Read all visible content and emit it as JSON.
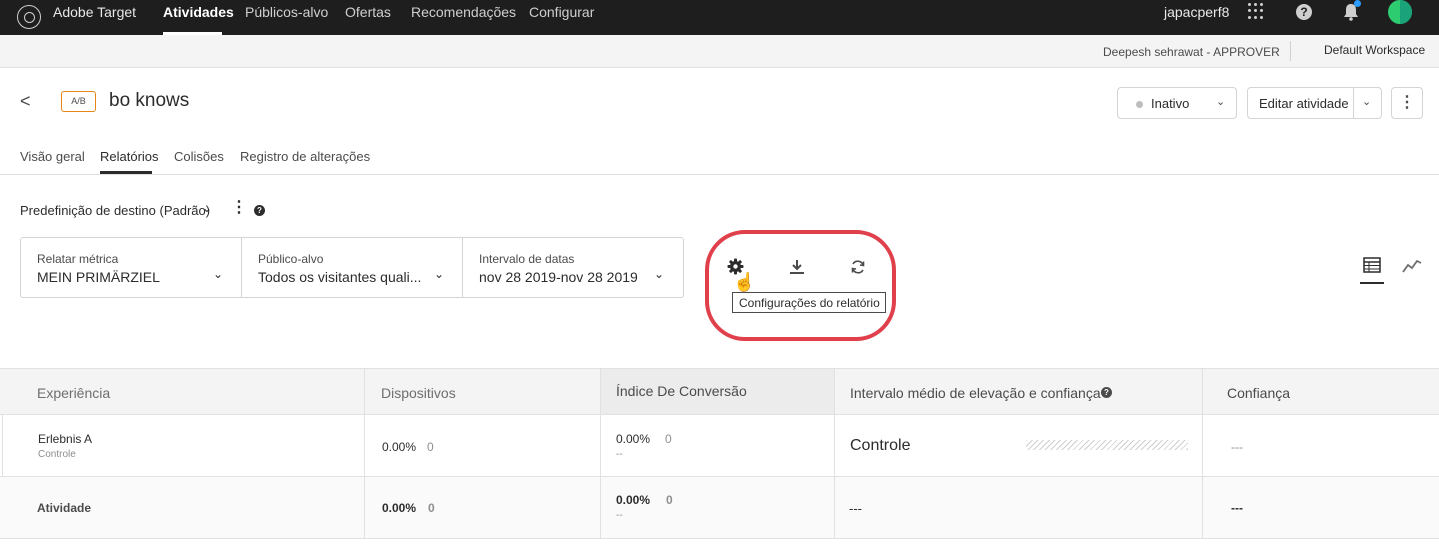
{
  "topnav": {
    "brand": "Adobe Target",
    "items": [
      {
        "label": "Atividades",
        "active": true
      },
      {
        "label": "Públicos-alvo"
      },
      {
        "label": "Ofertas"
      },
      {
        "label": "Recomendações"
      },
      {
        "label": "Configurar"
      }
    ],
    "user": "japacperf8",
    "help": "?"
  },
  "workspace_bar": {
    "user_role": "Deepesh sehrawat - APPROVER",
    "workspace": "Default Workspace"
  },
  "activity": {
    "back": "<",
    "type_badge": "A/B",
    "title": "bo knows",
    "status": "Inativo",
    "edit_label": "Editar atividade",
    "more": "⋮"
  },
  "tabs": [
    {
      "label": "Visão geral"
    },
    {
      "label": "Relatórios",
      "active": true
    },
    {
      "label": "Colisões"
    },
    {
      "label": "Registro de alterações"
    }
  ],
  "preset": {
    "label": "Predefinição de destino (Padrão)",
    "kebab": "⋮",
    "help": "?"
  },
  "selectors": [
    {
      "caption": "Relatar métrica",
      "value": "MEIN PRIMÄRZIEL"
    },
    {
      "caption": "Público-alvo",
      "value": "Todos os visitantes quali..."
    },
    {
      "caption": "Intervalo de datas",
      "value": "nov 28 2019-nov 28 2019"
    }
  ],
  "toolbar": {
    "settings_icon": "gear-icon",
    "download_icon": "download-icon",
    "refresh_icon": "refresh-icon",
    "tooltip": "Configurações do relatório",
    "highlight_color": "#e0404b"
  },
  "table": {
    "headers": [
      "Experiência",
      "Dispositivos",
      "Índice De Conversão",
      "Intervalo médio de elevação e confiança",
      "Confiança"
    ],
    "header_help": "?",
    "rows": [
      {
        "experience": "Erlebnis A",
        "sub": "Controle",
        "devices_pct": "0.00%",
        "devices_count": "0",
        "conv_pct": "0.00%",
        "conv_count": "0",
        "conv_sub": "--",
        "lift": "Controle",
        "confidence": "---"
      },
      {
        "experience": "Atividade",
        "devices_pct": "0.00%",
        "devices_count": "0",
        "conv_pct": "0.00%",
        "conv_count": "0",
        "conv_sub": "--",
        "lift": "---",
        "confidence": "---"
      }
    ]
  }
}
